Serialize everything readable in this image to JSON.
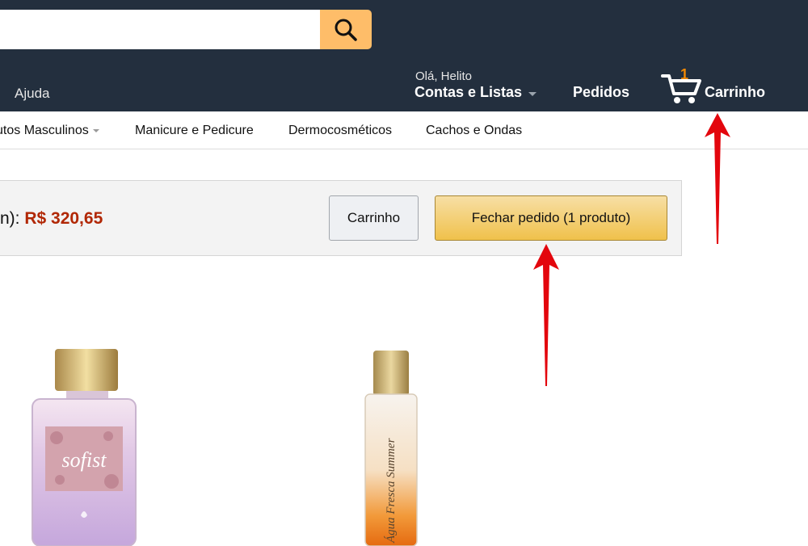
{
  "header": {
    "search": {
      "value": "",
      "placeholder": ""
    },
    "help_label": "Ajuda",
    "greeting": "Olá, Helito",
    "accounts_label": "Contas e Listas",
    "orders_label": "Pedidos",
    "cart": {
      "count": "1",
      "label": "Carrinho"
    }
  },
  "subnav": {
    "items": [
      "utos Masculinos",
      "Manicure e Pedicure",
      "Dermocosméticos",
      "Cachos e Ondas"
    ]
  },
  "cart_summary": {
    "subtotal_label": "n): ",
    "subtotal_value": "R$ 320,65",
    "cart_button": "Carrinho",
    "checkout_button": "Fechar pedido (1 produto)"
  },
  "products": [
    {
      "label_text": "sofist",
      "image_icon": "perfume-bottle-pink"
    },
    {
      "label_text": "Água Fresca Summer",
      "image_icon": "perfume-bottle-orange"
    }
  ],
  "colors": {
    "header_bg": "#232f3e",
    "search_button": "#febd69",
    "cart_count": "#f08804",
    "price": "#b12704",
    "annotation_arrow": "#e3060d"
  }
}
